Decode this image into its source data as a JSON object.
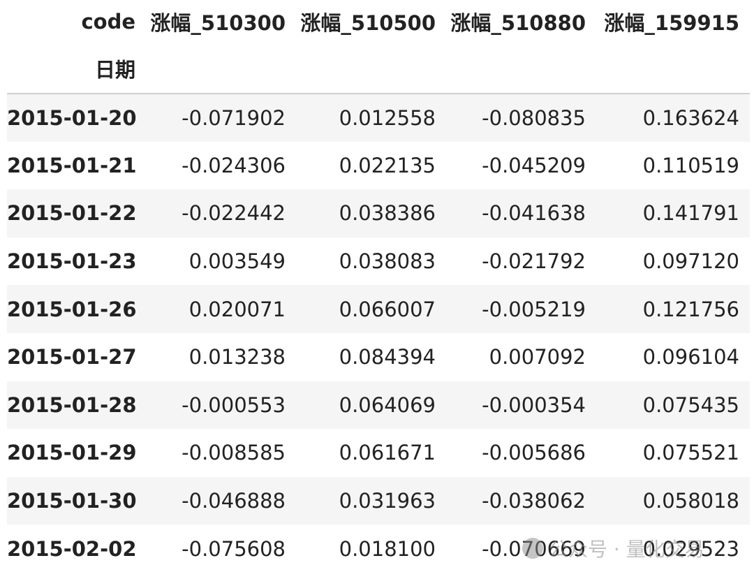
{
  "table": {
    "columns_label": "code",
    "index_label": "日期",
    "columns": [
      "涨幅_510300",
      "涨幅_510500",
      "涨幅_510880",
      "涨幅_159915"
    ],
    "rows": [
      {
        "date": "2015-01-20",
        "values": [
          "-0.071902",
          "0.012558",
          "-0.080835",
          "0.163624"
        ]
      },
      {
        "date": "2015-01-21",
        "values": [
          "-0.024306",
          "0.022135",
          "-0.045209",
          "0.110519"
        ]
      },
      {
        "date": "2015-01-22",
        "values": [
          "-0.022442",
          "0.038386",
          "-0.041638",
          "0.141791"
        ]
      },
      {
        "date": "2015-01-23",
        "values": [
          "0.003549",
          "0.038083",
          "-0.021792",
          "0.097120"
        ]
      },
      {
        "date": "2015-01-26",
        "values": [
          "0.020071",
          "0.066007",
          "-0.005219",
          "0.121756"
        ]
      },
      {
        "date": "2015-01-27",
        "values": [
          "0.013238",
          "0.084394",
          "0.007092",
          "0.096104"
        ]
      },
      {
        "date": "2015-01-28",
        "values": [
          "-0.000553",
          "0.064069",
          "-0.000354",
          "0.075435"
        ]
      },
      {
        "date": "2015-01-29",
        "values": [
          "-0.008585",
          "0.061671",
          "-0.005686",
          "0.075521"
        ]
      },
      {
        "date": "2015-01-30",
        "values": [
          "-0.046888",
          "0.031963",
          "-0.038062",
          "0.058018"
        ]
      },
      {
        "date": "2015-02-02",
        "values": [
          "-0.075608",
          "0.018100",
          "-0.070669",
          "0.029523"
        ]
      }
    ]
  },
  "watermark": {
    "text": "公众号 · 量化交易",
    "icon": "wechat-icon"
  }
}
